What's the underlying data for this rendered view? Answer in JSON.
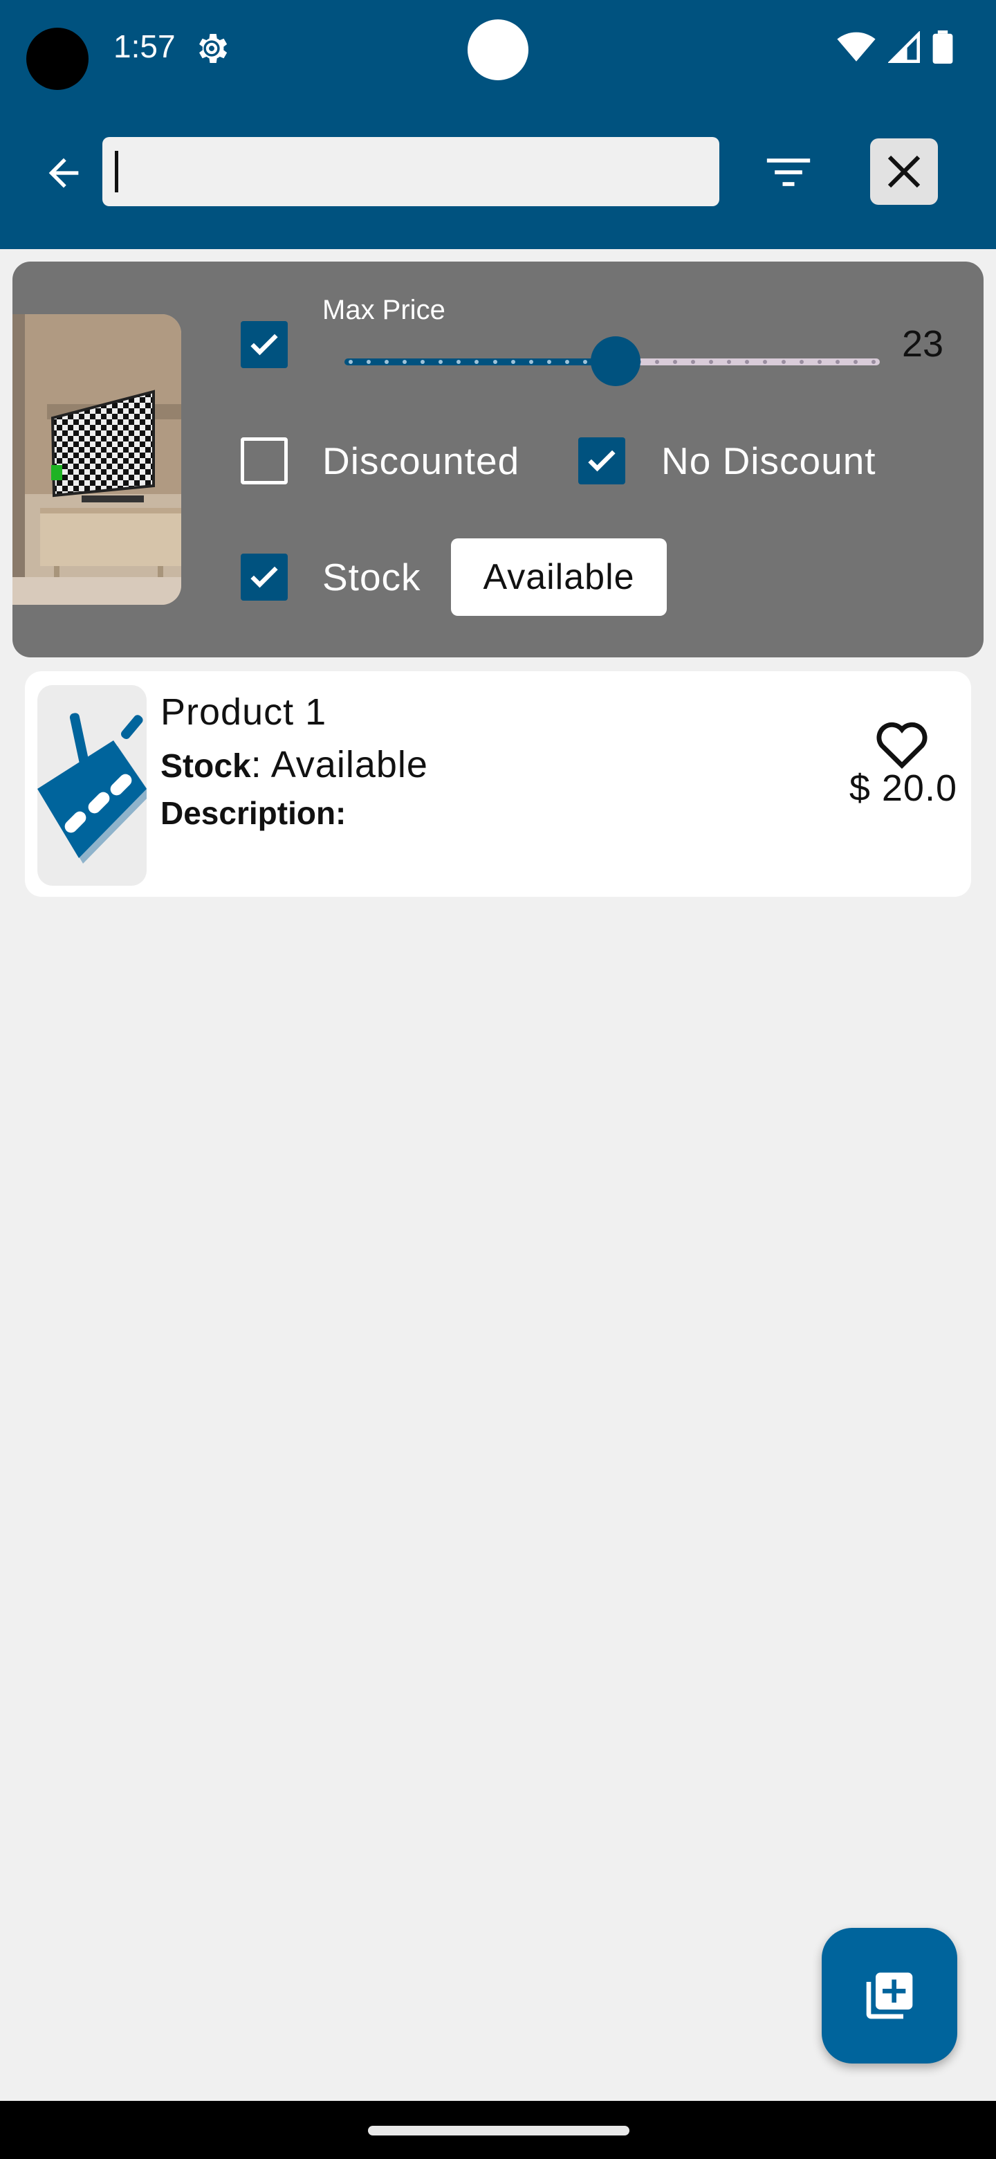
{
  "status_bar": {
    "time": "1:57",
    "icons": [
      "gear-icon",
      "wifi-icon",
      "signal-icon",
      "battery-icon"
    ]
  },
  "app_bar": {
    "back_icon": "arrow-left-icon",
    "search": {
      "value": "",
      "placeholder": ""
    },
    "filter_icon": "filter-icon",
    "clear_icon": "close-icon"
  },
  "filters": {
    "max_price": {
      "label": "Max Price",
      "enabled": true,
      "value": "23",
      "fraction": 0.48
    },
    "discounted": {
      "label": "Discounted",
      "checked": false
    },
    "no_discount": {
      "label": "No Discount",
      "checked": true
    },
    "stock": {
      "label": "Stock",
      "checked": true,
      "selected": "Available"
    }
  },
  "products": [
    {
      "name": "Product 1",
      "stock_label": "Stock",
      "stock_value": ": Available",
      "description_label": "Description:",
      "price": "$ 20.0",
      "favorite_icon": "heart-outline-icon"
    }
  ],
  "fab": {
    "icon": "add-to-library-icon"
  },
  "colors": {
    "primary": "#00527f",
    "panel": "#737373",
    "background": "#f0f0f0",
    "fab": "#00649c"
  }
}
